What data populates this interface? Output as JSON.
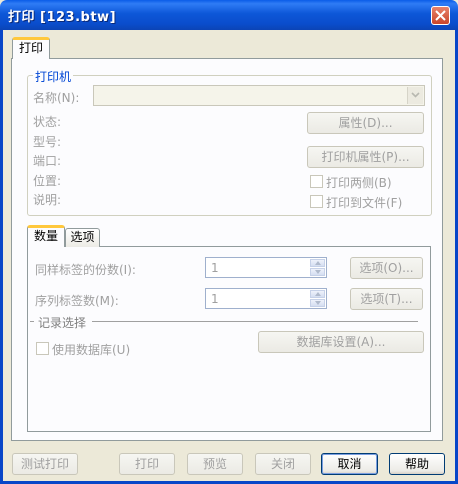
{
  "window": {
    "title": "打印 [123.btw]"
  },
  "tabs": {
    "print": "打印"
  },
  "printer": {
    "legend": "打印机",
    "name_label": "名称(N):",
    "name_value": "",
    "status_label": "状态:",
    "type_label": "型号:",
    "port_label": "端口:",
    "location_label": "位置:",
    "comment_label": "说明:",
    "properties_button": "属性(D)...",
    "printer_properties_button": "打印机属性(P)...",
    "duplex_label": "打印两侧(B)",
    "print_to_file_label": "打印到文件(F)"
  },
  "inner_tabs": {
    "quantity": "数量",
    "options": "选项"
  },
  "quantity": {
    "copies_label": "同样标签的份数(I):",
    "copies_value": "1",
    "copies_options_button": "选项(O)...",
    "serial_label": "序列标签数(M):",
    "serial_value": "1",
    "serial_options_button": "选项(T)...",
    "record_select_legend": "记录选择",
    "use_database_label": "使用数据库(U)",
    "database_setup_button": "数据库设置(A)..."
  },
  "footer": {
    "test_print": "测试打印",
    "print": "打印",
    "preview": "预览",
    "close": "关闭",
    "cancel": "取消",
    "help": "帮助"
  },
  "colors": {
    "titlebar": "#0a5ce8",
    "tab_accent": "#ffc83c",
    "legend": "#0046d5",
    "disabled_text": "#a0a0a0"
  }
}
